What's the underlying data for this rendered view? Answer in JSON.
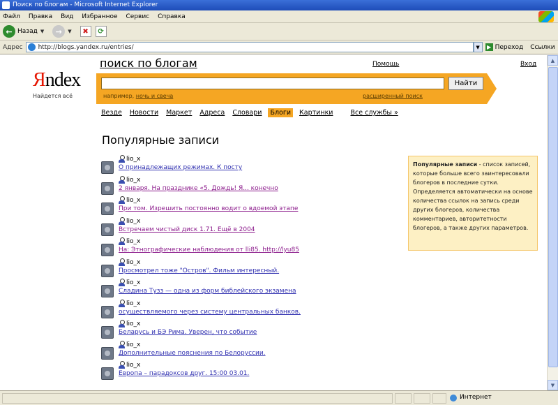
{
  "window": {
    "title": "Поиск по блогам - Microsoft Internet Explorer",
    "menu": [
      "Файл",
      "Правка",
      "Вид",
      "Избранное",
      "Сервис",
      "Справка"
    ],
    "toolbar": {
      "back_label": "Назад"
    },
    "address": {
      "label": "Адрес",
      "url": "http://blogs.yandex.ru/entries/",
      "go_label": "Переход",
      "links_label": "Ссылки"
    },
    "status": {
      "zone_label": "Интернет"
    }
  },
  "page": {
    "logo": {
      "first": "Я",
      "rest": "ndex",
      "tagline": "Найдется всё"
    },
    "search_title": "поиск по блогам",
    "advanced_link": "Помощь",
    "enter_link": "Вход",
    "search": {
      "button_label": "Найти",
      "hint_prefix": "например, ",
      "hint_example": "ночь и свеча",
      "extended_link": "расширенный поиск"
    },
    "nav": {
      "tabs": [
        "Везде",
        "Новости",
        "Маркет",
        "Адреса",
        "Словари",
        "Блоги",
        "Картинки"
      ],
      "active_index": 5,
      "all_services": "Все службы »"
    },
    "section_title": "Популярные записи",
    "entries": [
      {
        "user": "lio_x",
        "title": "О принадлежащих режимах. К посту",
        "visited": false
      },
      {
        "user": "lio_x",
        "title": "2 января. На празднике «5. Дождь! Я... конечно",
        "visited": true
      },
      {
        "user": "lio_x",
        "title": "При том. Изрешить постоянно водит о вдоемой этапе",
        "visited": true
      },
      {
        "user": "lio_x",
        "title": "Встречаем чистый диск 1.71. Ещё в 2004",
        "visited": true
      },
      {
        "user": "lio_x",
        "title": "На: Этнографические наблюдения от lli85. http://lyu85",
        "visited": true
      },
      {
        "user": "lio_x",
        "title": "Просмотрел тоже \"Остров\". Фильм интересный.",
        "visited": false
      },
      {
        "user": "lio_x",
        "title": "Сладина Тузз — одна из форм библейского экзамена",
        "visited": false
      },
      {
        "user": "lio_x",
        "title": "осуществляемого через систему центральных банков.",
        "visited": false
      },
      {
        "user": "lio_x",
        "title": "Беларусь и БЭ Рима. Уверен, что событие",
        "visited": false
      },
      {
        "user": "lio_x",
        "title": "Дополнительные пояснения по Белоруссии.",
        "visited": false
      },
      {
        "user": "lio_x",
        "title": "Европа – парадоксов друг. 15:00 03.01.",
        "visited": false
      }
    ],
    "info_box": {
      "title": "Популярные записи",
      "text": " - список записей, которые больше всего заинтересовали блогеров в последние сутки. Определяется автоматически на основе количества ссылок на запись среди других блогеров, количества комментариев, авторитетности блогеров, а также других параметров."
    }
  }
}
